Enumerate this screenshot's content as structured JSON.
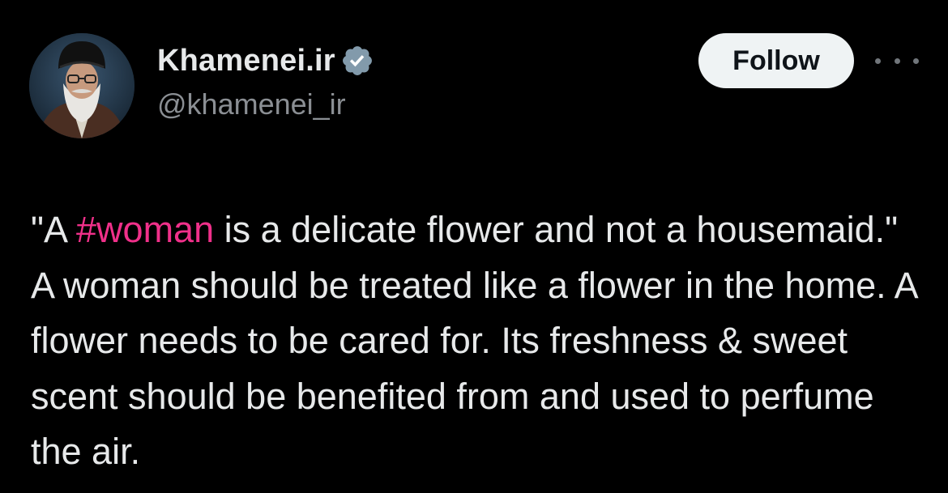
{
  "author": {
    "display_name": "Khamenei.ir",
    "handle": "@khamenei_ir",
    "verified": true,
    "avatar_alt": "avatar"
  },
  "actions": {
    "follow_label": "Follow",
    "more_icon": "more-horizontal-icon"
  },
  "tweet": {
    "text_before": "\"A ",
    "hashtag": "#woman",
    "text_after": " is a delicate flower and not a housemaid.\" A woman should be treated like a flower in the home. A flower needs to be cared for. Its freshness & sweet scent should be benefited from and used to perfume the air."
  },
  "colors": {
    "background": "#000000",
    "text": "#e7e9ea",
    "secondary_text": "#8b8f94",
    "hashtag": "#f0308a",
    "follow_button_bg": "#eff3f4",
    "verified_badge": "#829aab"
  }
}
